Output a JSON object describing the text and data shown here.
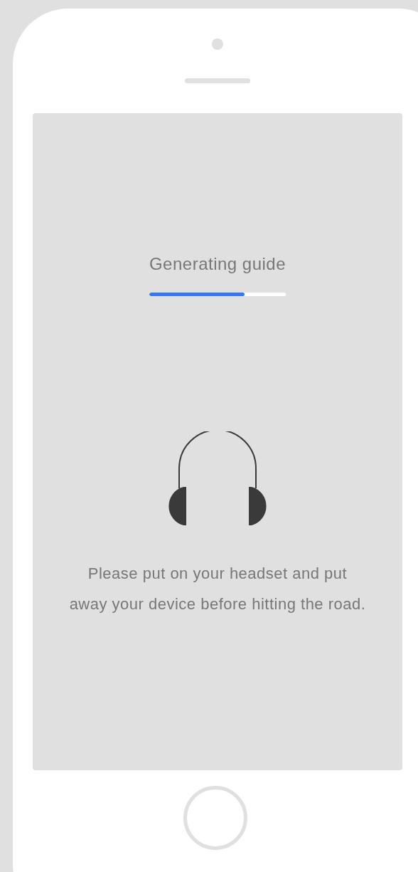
{
  "screen": {
    "title": "Generating guide",
    "progress": {
      "level": 0.7
    },
    "message": "Please put on your headset and put away your device before hitting the road."
  }
}
